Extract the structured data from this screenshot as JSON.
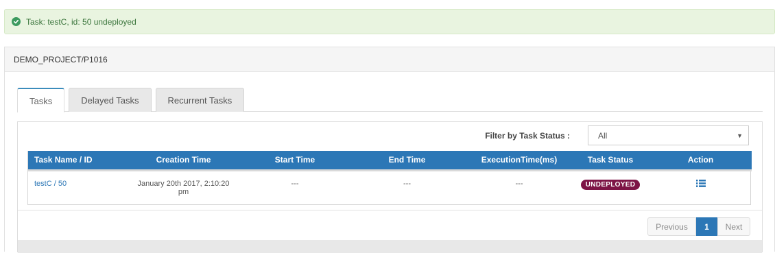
{
  "alert": {
    "message": "Task: testC, id: 50 undeployed",
    "icon": "check-circle-icon",
    "color": "#3c763d"
  },
  "panel": {
    "heading": "DEMO_PROJECT/P1016"
  },
  "tabs": [
    {
      "label": "Tasks",
      "active": true
    },
    {
      "label": "Delayed Tasks",
      "active": false
    },
    {
      "label": "Recurrent Tasks",
      "active": false
    }
  ],
  "filter": {
    "label": "Filter by Task Status :",
    "selected": "All"
  },
  "table": {
    "columns": [
      "Task Name / ID",
      "Creation Time",
      "Start Time",
      "End Time",
      "ExecutionTime(ms)",
      "Task Status",
      "Action"
    ],
    "rows": [
      {
        "name": "testC / 50",
        "creation_line1": "January 20th 2017, 2:10:20",
        "creation_line2": "pm",
        "start": "---",
        "end": "---",
        "execution": "---",
        "status": "UNDEPLOYED",
        "action_icon": "list-icon"
      }
    ]
  },
  "pagination": {
    "previous": "Previous",
    "current": "1",
    "next": "Next"
  },
  "colors": {
    "header_blue": "#2c77b6",
    "status_badge": "#7d1446",
    "alert_bg": "#e9f4e0"
  }
}
